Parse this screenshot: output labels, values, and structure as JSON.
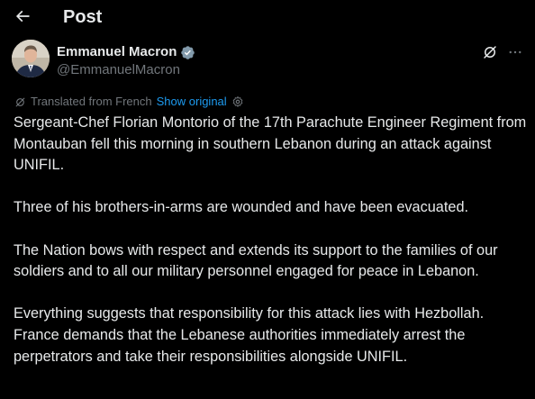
{
  "header": {
    "title": "Post",
    "back_icon": "arrow-left-icon"
  },
  "author": {
    "display_name": "Emmanuel Macron",
    "handle": "@EmmanuelMacron",
    "verified_color": "#829aab"
  },
  "translation": {
    "label": "Translated from French",
    "show_original": "Show original"
  },
  "post": {
    "paragraphs": [
      "Sergeant-Chef Florian Montorio of the 17th Parachute Engineer Regiment from Montauban fell this morning in southern Lebanon during an attack against UNIFIL.",
      "Three of his brothers-in-arms are wounded and have been evacuated.",
      "The Nation bows with respect and extends its support to the families of our soldiers and to all our military personnel engaged for peace in Lebanon.",
      "Everything suggests that responsibility for this attack lies with Hezbollah. France demands that the Lebanese authorities immediately arrest the perpetrators and take their responsibilities alongside UNIFIL."
    ]
  },
  "colors": {
    "background": "#000000",
    "text": "#e7e9ea",
    "secondary": "#71767b",
    "link": "#1d9bf0"
  }
}
